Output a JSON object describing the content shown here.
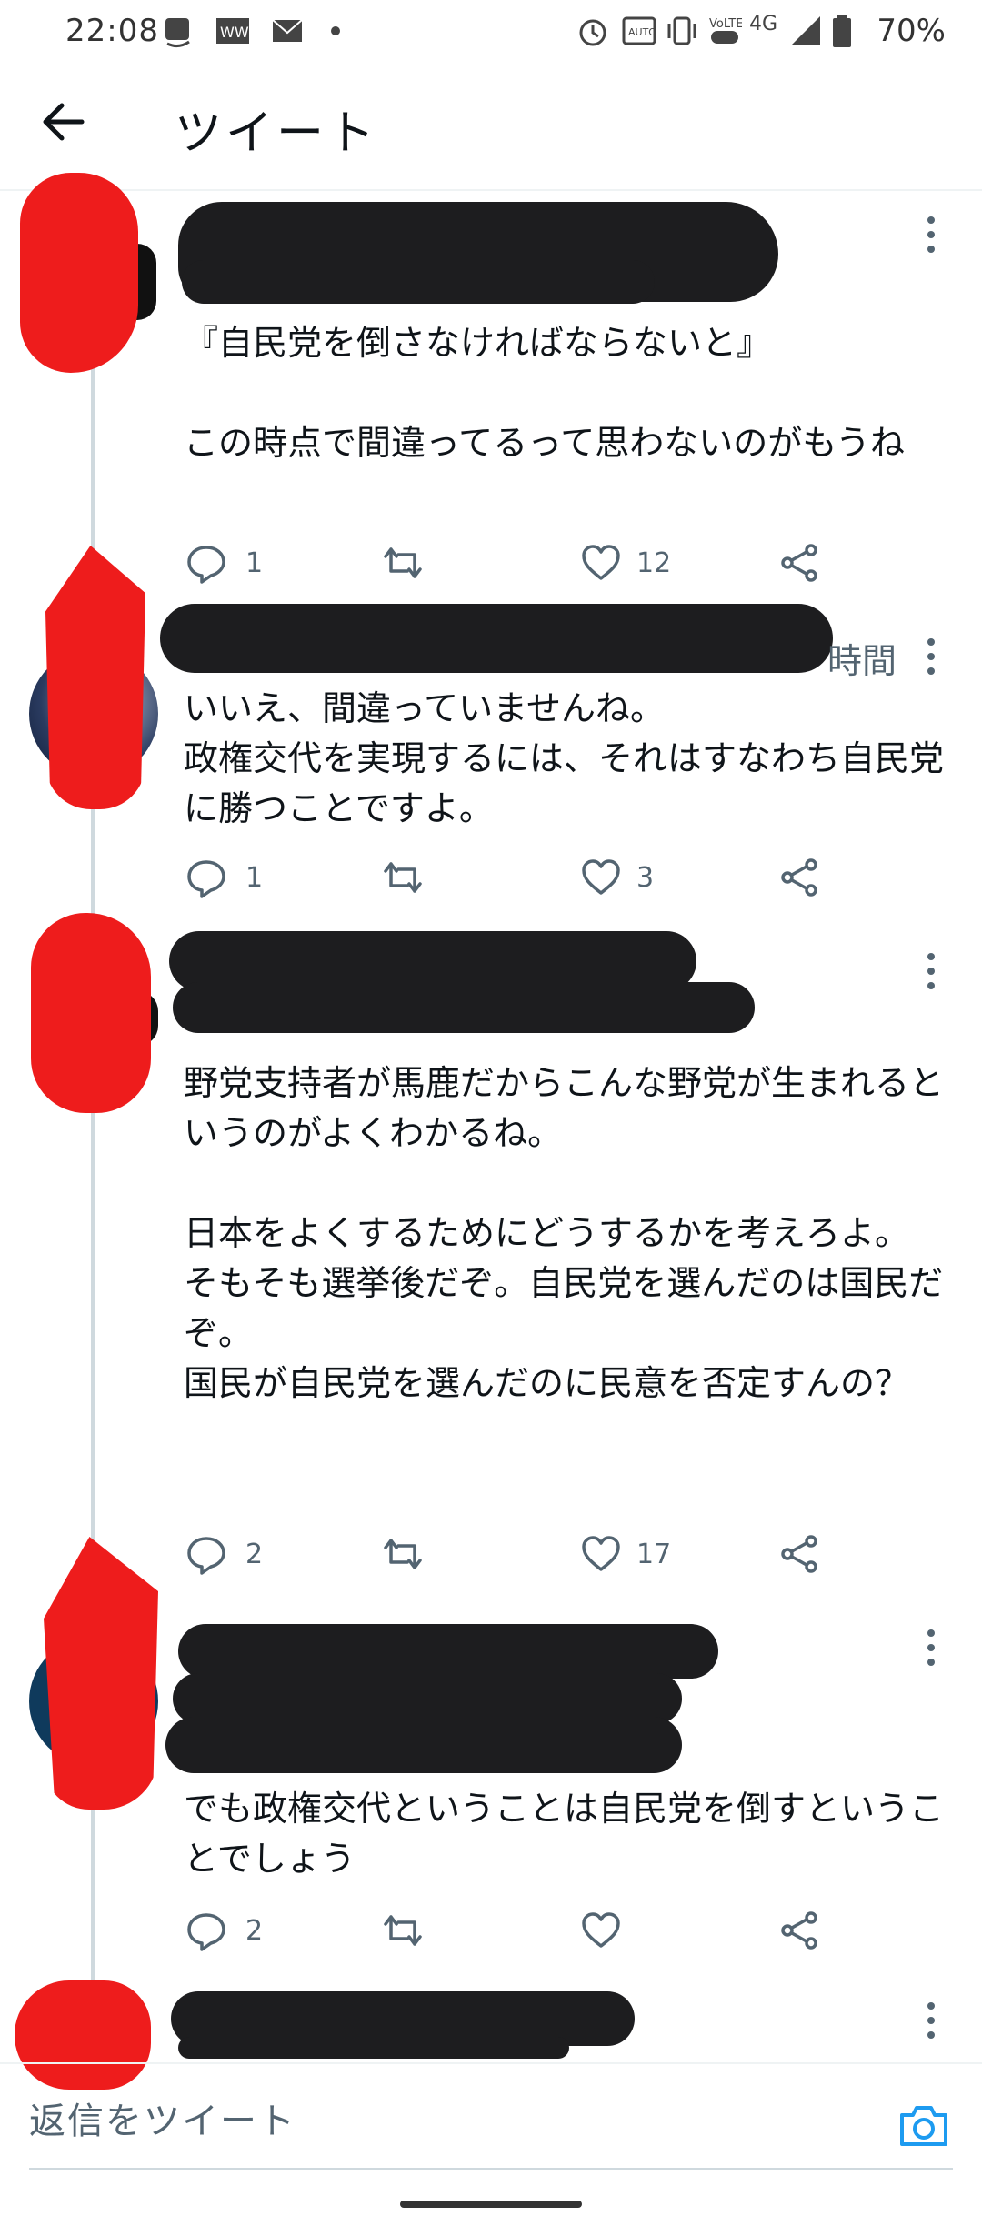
{
  "status_bar": {
    "time": "22:08",
    "battery": "70%",
    "network": "4G",
    "icons": [
      "amazon-icon",
      "app-icon",
      "mail-icon",
      "dot-icon",
      "alarm-icon",
      "auto-icon",
      "vibrate-icon",
      "volte-icon",
      "signal-icon",
      "battery-icon"
    ]
  },
  "header": {
    "title": "ツイート"
  },
  "tweets": [
    {
      "text": "『自民党を倒さなければならないと』\n\nこの時点で間違ってるって思わないのがもうね",
      "replies": "1",
      "retweets": "",
      "likes": "12"
    },
    {
      "time_suffix": "時間",
      "text": "いいえ、間違っていませんね。\n政権交代を実現するには、それはすなわち自民党に勝つことですよ。",
      "replies": "1",
      "retweets": "",
      "likes": "3"
    },
    {
      "text": "野党支持者が馬鹿だからこんな野党が生まれるというのがよくわかるね。\n\n日本をよくするためにどうするかを考えろよ。\nそもそも選挙後だぞ。自民党を選んだのは国民だぞ。\n国民が自民党を選んだのに民意を否定すんの？",
      "replies": "2",
      "retweets": "",
      "likes": "17"
    },
    {
      "text": "でも政権交代ということは自民党を倒すということでしょう",
      "replies": "2",
      "retweets": "",
      "likes": ""
    }
  ],
  "reply_bar": {
    "placeholder": "返信をツイート"
  },
  "colors": {
    "accent": "#1d9bf0",
    "redaction_red": "#ee1c1c",
    "redaction_black": "#1d1d1f"
  }
}
